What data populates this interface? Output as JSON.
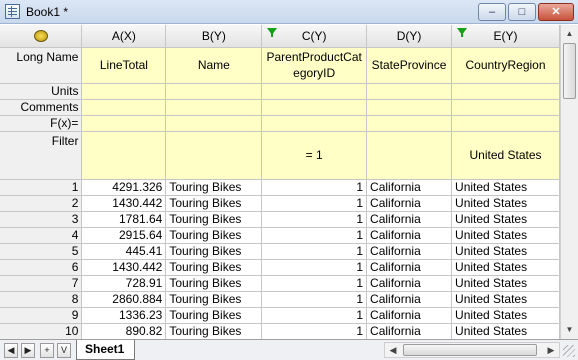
{
  "window": {
    "title": "Book1 *",
    "min": "–",
    "max": "□",
    "close": "✕"
  },
  "columns": [
    {
      "header": "A(X)",
      "long_name": "LineTotal",
      "units": "",
      "comments": "",
      "fx": "",
      "filter": "",
      "filtered": false
    },
    {
      "header": "B(Y)",
      "long_name": "Name",
      "units": "",
      "comments": "",
      "fx": "",
      "filter": "",
      "filtered": false
    },
    {
      "header": "C(Y)",
      "long_name": "ParentProductCategoryID",
      "units": "",
      "comments": "",
      "fx": "",
      "filter": "= 1",
      "filtered": true
    },
    {
      "header": "D(Y)",
      "long_name": "StateProvince",
      "units": "",
      "comments": "",
      "fx": "",
      "filter": "",
      "filtered": false
    },
    {
      "header": "E(Y)",
      "long_name": "CountryRegion",
      "units": "",
      "comments": "",
      "fx": "",
      "filter": "United States",
      "filtered": true
    }
  ],
  "row_labels": {
    "long_name": "Long Name",
    "units": "Units",
    "comments": "Comments",
    "fx": "F(x)=",
    "filter": "Filter"
  },
  "rows": [
    {
      "n": "1",
      "a": "4291.326",
      "b": "Touring Bikes",
      "c": "1",
      "d": "California",
      "e": "United States"
    },
    {
      "n": "2",
      "a": "1430.442",
      "b": "Touring Bikes",
      "c": "1",
      "d": "California",
      "e": "United States"
    },
    {
      "n": "3",
      "a": "1781.64",
      "b": "Touring Bikes",
      "c": "1",
      "d": "California",
      "e": "United States"
    },
    {
      "n": "4",
      "a": "2915.64",
      "b": "Touring Bikes",
      "c": "1",
      "d": "California",
      "e": "United States"
    },
    {
      "n": "5",
      "a": "445.41",
      "b": "Touring Bikes",
      "c": "1",
      "d": "California",
      "e": "United States"
    },
    {
      "n": "6",
      "a": "1430.442",
      "b": "Touring Bikes",
      "c": "1",
      "d": "California",
      "e": "United States"
    },
    {
      "n": "7",
      "a": "728.91",
      "b": "Touring Bikes",
      "c": "1",
      "d": "California",
      "e": "United States"
    },
    {
      "n": "8",
      "a": "2860.884",
      "b": "Touring Bikes",
      "c": "1",
      "d": "California",
      "e": "United States"
    },
    {
      "n": "9",
      "a": "1336.23",
      "b": "Touring Bikes",
      "c": "1",
      "d": "California",
      "e": "United States"
    },
    {
      "n": "10",
      "a": "890.82",
      "b": "Touring Bikes",
      "c": "1",
      "d": "California",
      "e": "United States"
    }
  ],
  "sheet_nav": {
    "prev": "◀",
    "next": "▶",
    "add": "+",
    "menu": "V"
  },
  "sheet_tab": "Sheet1",
  "colors": {
    "meta_bg": "#ffffc6",
    "filter_icon": "#19a019"
  },
  "icons": {
    "corner": "worksheet-options-icon",
    "filter": "filter-icon"
  }
}
